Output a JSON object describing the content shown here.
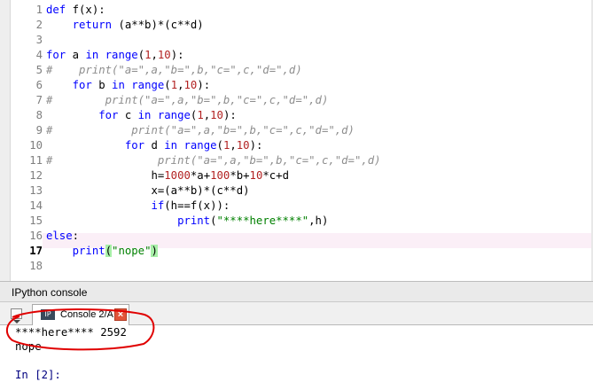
{
  "editor": {
    "current_line": "17",
    "lines": [
      {
        "n": "1",
        "tokens": [
          {
            "t": "def ",
            "c": "kw"
          },
          {
            "t": "f(x):",
            "c": "fn"
          }
        ]
      },
      {
        "n": "2",
        "tokens": [
          {
            "t": "    return ",
            "c": "kw"
          },
          {
            "t": "(a**b)*(c**d)",
            "c": "op"
          }
        ]
      },
      {
        "n": "3",
        "tokens": []
      },
      {
        "n": "4",
        "tokens": [
          {
            "t": "for ",
            "c": "kw"
          },
          {
            "t": "a ",
            "c": "op"
          },
          {
            "t": "in ",
            "c": "kw"
          },
          {
            "t": "range",
            "c": "kw"
          },
          {
            "t": "(",
            "c": "op"
          },
          {
            "t": "1",
            "c": "num"
          },
          {
            "t": ",",
            "c": "op"
          },
          {
            "t": "10",
            "c": "num"
          },
          {
            "t": "):",
            "c": "op"
          }
        ]
      },
      {
        "n": "5",
        "tokens": [
          {
            "t": "#    print(\"a=\",a,\"b=\",b,\"c=\",c,\"d=\",d)",
            "c": "cm"
          }
        ]
      },
      {
        "n": "6",
        "tokens": [
          {
            "t": "    for ",
            "c": "kw"
          },
          {
            "t": "b ",
            "c": "op"
          },
          {
            "t": "in ",
            "c": "kw"
          },
          {
            "t": "range",
            "c": "kw"
          },
          {
            "t": "(",
            "c": "op"
          },
          {
            "t": "1",
            "c": "num"
          },
          {
            "t": ",",
            "c": "op"
          },
          {
            "t": "10",
            "c": "num"
          },
          {
            "t": "):",
            "c": "op"
          }
        ]
      },
      {
        "n": "7",
        "tokens": [
          {
            "t": "#        print(\"a=\",a,\"b=\",b,\"c=\",c,\"d=\",d)",
            "c": "cm"
          }
        ]
      },
      {
        "n": "8",
        "tokens": [
          {
            "t": "        for ",
            "c": "kw"
          },
          {
            "t": "c ",
            "c": "op"
          },
          {
            "t": "in ",
            "c": "kw"
          },
          {
            "t": "range",
            "c": "kw"
          },
          {
            "t": "(",
            "c": "op"
          },
          {
            "t": "1",
            "c": "num"
          },
          {
            "t": ",",
            "c": "op"
          },
          {
            "t": "10",
            "c": "num"
          },
          {
            "t": "):",
            "c": "op"
          }
        ]
      },
      {
        "n": "9",
        "tokens": [
          {
            "t": "#            print(\"a=\",a,\"b=\",b,\"c=\",c,\"d=\",d)",
            "c": "cm"
          }
        ]
      },
      {
        "n": "10",
        "tokens": [
          {
            "t": "            for ",
            "c": "kw"
          },
          {
            "t": "d ",
            "c": "op"
          },
          {
            "t": "in ",
            "c": "kw"
          },
          {
            "t": "range",
            "c": "kw"
          },
          {
            "t": "(",
            "c": "op"
          },
          {
            "t": "1",
            "c": "num"
          },
          {
            "t": ",",
            "c": "op"
          },
          {
            "t": "10",
            "c": "num"
          },
          {
            "t": "):",
            "c": "op"
          }
        ]
      },
      {
        "n": "11",
        "tokens": [
          {
            "t": "#                print(\"a=\",a,\"b=\",b,\"c=\",c,\"d=\",d)",
            "c": "cm"
          }
        ]
      },
      {
        "n": "12",
        "tokens": [
          {
            "t": "                h=",
            "c": "op"
          },
          {
            "t": "1000",
            "c": "num"
          },
          {
            "t": "*a+",
            "c": "op"
          },
          {
            "t": "100",
            "c": "num"
          },
          {
            "t": "*b+",
            "c": "op"
          },
          {
            "t": "10",
            "c": "num"
          },
          {
            "t": "*c+d",
            "c": "op"
          }
        ]
      },
      {
        "n": "13",
        "tokens": [
          {
            "t": "                x=(a**b)*(c**d)",
            "c": "op"
          }
        ]
      },
      {
        "n": "14",
        "tokens": [
          {
            "t": "                if",
            "c": "kw"
          },
          {
            "t": "(h==f(x)):",
            "c": "op"
          }
        ]
      },
      {
        "n": "15",
        "tokens": [
          {
            "t": "                    print",
            "c": "kw"
          },
          {
            "t": "(",
            "c": "op"
          },
          {
            "t": "\"****here****\"",
            "c": "str"
          },
          {
            "t": ",h)",
            "c": "op"
          }
        ]
      },
      {
        "n": "16",
        "tokens": [
          {
            "t": "else",
            "c": "kw"
          },
          {
            "t": ":",
            "c": "op"
          }
        ]
      },
      {
        "n": "17",
        "tokens": [
          {
            "t": "    print",
            "c": "kw"
          },
          {
            "t": "(",
            "c": "bm"
          },
          {
            "t": "\"nope\"",
            "c": "str"
          },
          {
            "t": ")",
            "c": "bm"
          }
        ]
      },
      {
        "n": "18",
        "tokens": []
      }
    ]
  },
  "console": {
    "panel_title": "IPython console",
    "tab_label": "Console 2/A",
    "tab_icon_text": "IP",
    "output": [
      "****here**** 2592",
      "nope"
    ],
    "prompt": "In [2]:"
  },
  "colors": {
    "keyword": "#0000ff",
    "number": "#b22222",
    "string": "#008000",
    "comment": "#8e8e8e",
    "annotation": "#e00000"
  }
}
